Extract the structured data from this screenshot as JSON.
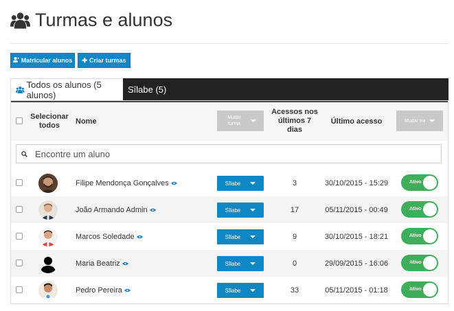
{
  "page": {
    "title": "Turmas e alunos",
    "icon": "users-icon"
  },
  "actions": {
    "enroll_label": "Matricular alunos",
    "create_label": "Criar turmas"
  },
  "tabs": [
    {
      "label": "Todos os alunos (5 alunos)"
    },
    {
      "label": "Sîlabe (5)"
    }
  ],
  "table": {
    "headers": {
      "select_all": "Selecionar todos",
      "name": "Nome",
      "change_class": "Mudar turma",
      "accesses": "Acessos nos últimos 7 dias",
      "last_access": "Último acesso",
      "change_enrollment": "Mudar matrí..."
    },
    "search_placeholder": "Encontre um aluno",
    "rows": [
      {
        "name": "Filipe Mendonça Gonçalves",
        "class": "Sîlabe",
        "accesses": "3",
        "last_access": "30/10/2015 - 15:29",
        "status": "Ativo"
      },
      {
        "name": "João Armando Admin",
        "class": "Sîlabe",
        "accesses": "17",
        "last_access": "05/11/2015 - 00:49",
        "status": "Ativo"
      },
      {
        "name": "Marcos Soledade",
        "class": "Sîlabe",
        "accesses": "9",
        "last_access": "30/10/2015 - 18:21",
        "status": "Ativo"
      },
      {
        "name": "Maria Beatriz",
        "class": "Sîlabe",
        "accesses": "0",
        "last_access": "29/09/2015 - 16:06",
        "status": "Ativo"
      },
      {
        "name": "Pedro Pereira",
        "class": "Sîlabe",
        "accesses": "33",
        "last_access": "05/11/2015 - 01:18",
        "status": "Ativo"
      }
    ]
  },
  "colors": {
    "primary": "#0e87c4",
    "active_toggle": "#3eae5b",
    "tab_bar": "#222222",
    "disabled_button": "#c9c9c9"
  }
}
